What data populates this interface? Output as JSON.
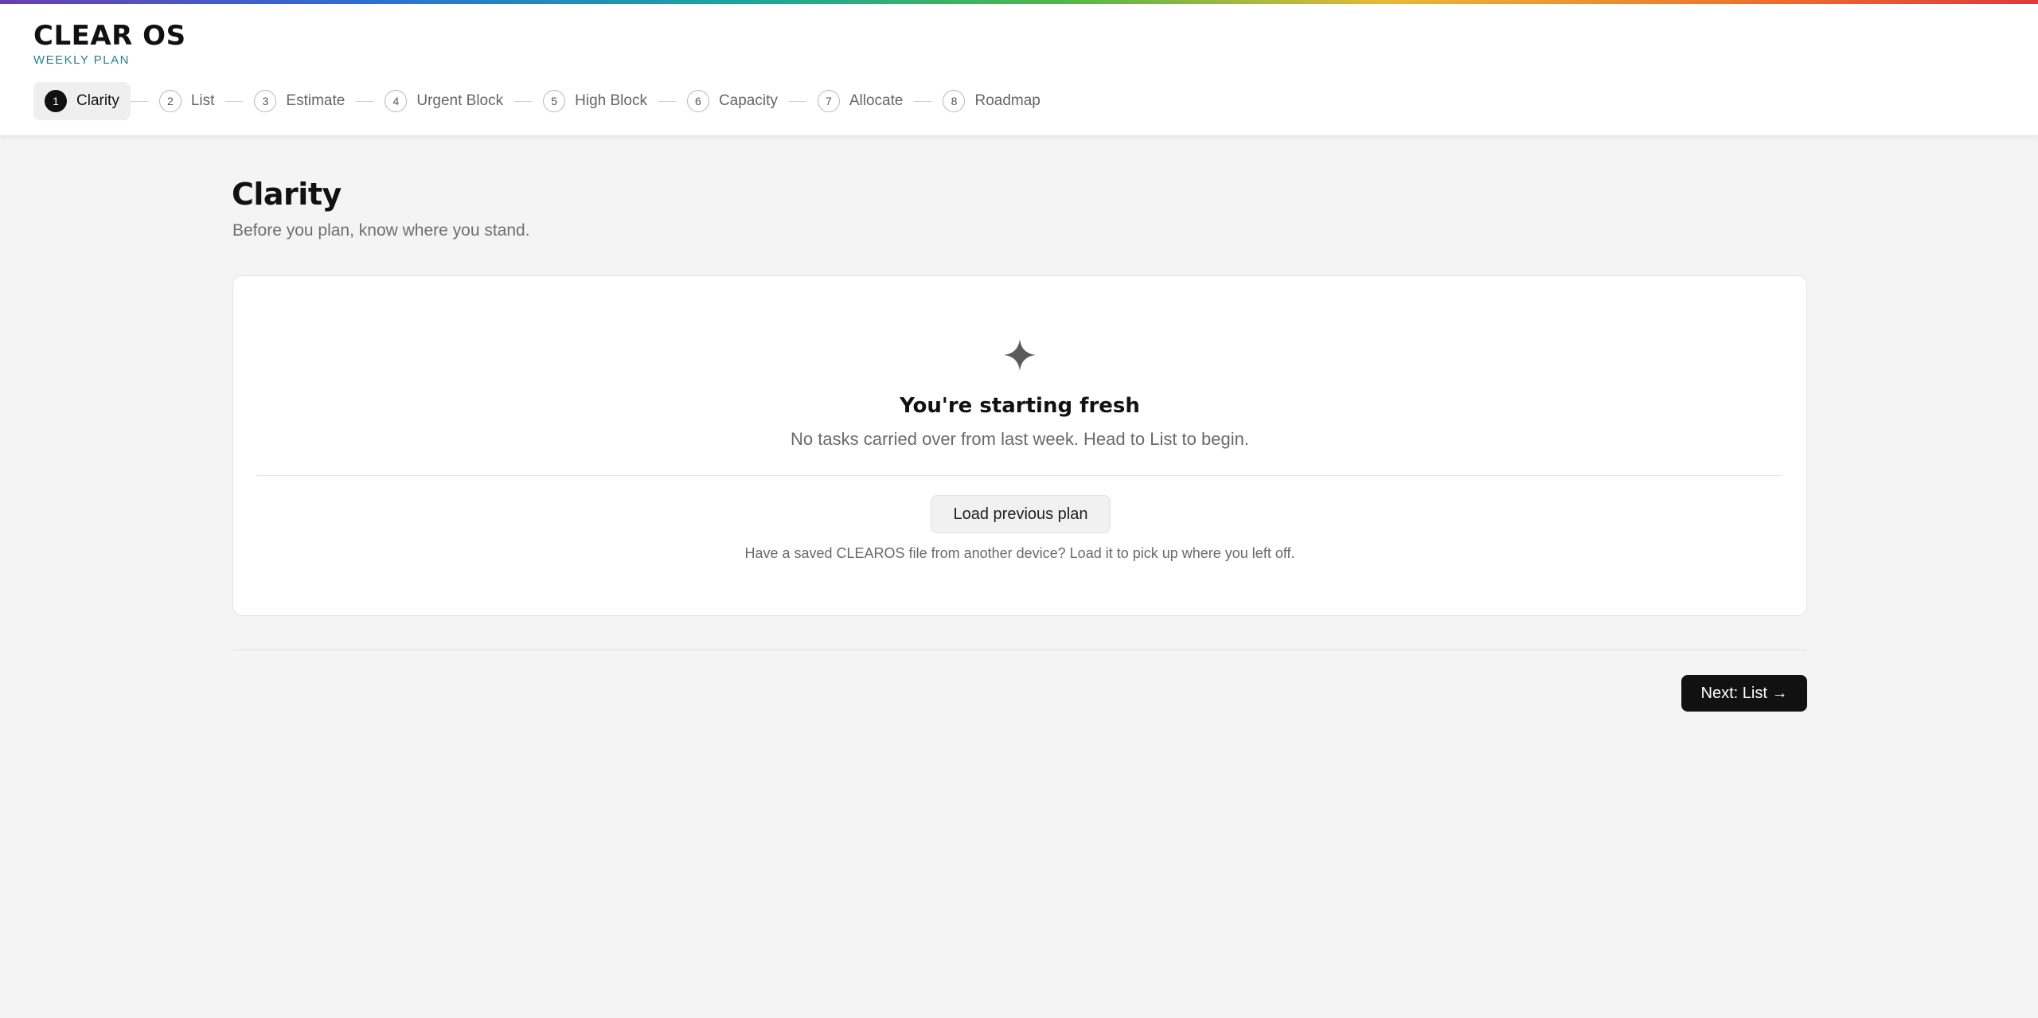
{
  "app": {
    "title": "CLEAR OS",
    "subtitle": "WEEKLY PLAN"
  },
  "colors": {
    "accent_teal": "#2c7f86",
    "primary": "#111111",
    "background": "#f4f4f4"
  },
  "steps": [
    {
      "num": "1",
      "label": "Clarity",
      "active": true
    },
    {
      "num": "2",
      "label": "List"
    },
    {
      "num": "3",
      "label": "Estimate"
    },
    {
      "num": "4",
      "label": "Urgent Block"
    },
    {
      "num": "5",
      "label": "High Block"
    },
    {
      "num": "6",
      "label": "Capacity"
    },
    {
      "num": "7",
      "label": "Allocate"
    },
    {
      "num": "8",
      "label": "Roadmap"
    }
  ],
  "page": {
    "title": "Clarity",
    "subtitle": "Before you plan, know where you stand."
  },
  "card": {
    "icon": "sparkle-icon",
    "heading": "You're starting fresh",
    "text": "No tasks carried over from last week. Head to List to begin.",
    "load_button": "Load previous plan",
    "hint": "Have a saved CLEAROS file from another device? Load it to pick up where you left off."
  },
  "footer": {
    "next_button": "Next: List →"
  }
}
